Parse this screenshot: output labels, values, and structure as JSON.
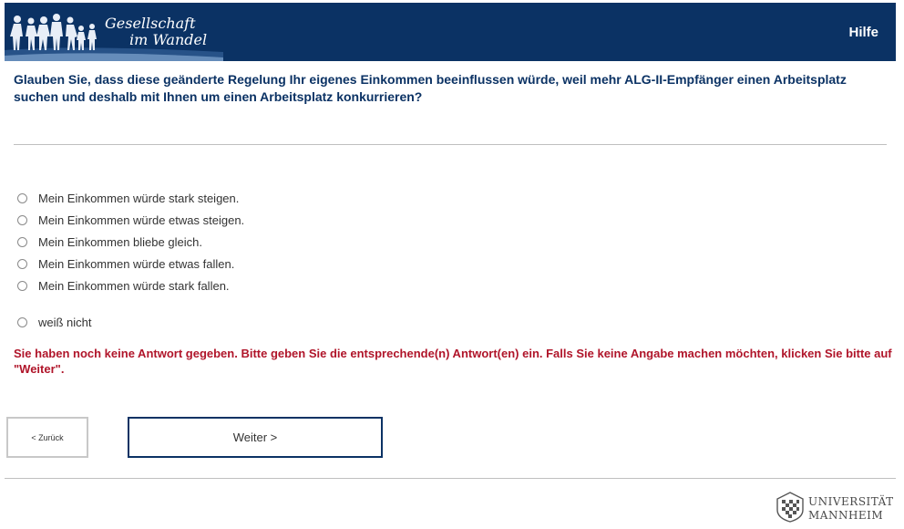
{
  "header": {
    "logo_line1": "Gesellschaft",
    "logo_line2": "im Wandel",
    "help_label": "Hilfe",
    "background": "#0b3264"
  },
  "question": {
    "text": "Glauben Sie, dass diese geänderte Regelung Ihr eigenes Einkommen beeinflussen würde, weil mehr ALG-II-Empfänger einen Arbeitsplatz suchen und deshalb mit Ihnen um einen Arbeitsplatz konkurrieren?",
    "color": "#0b3264"
  },
  "options": [
    {
      "label": "Mein Einkommen würde stark steigen.",
      "selected": false
    },
    {
      "label": "Mein Einkommen würde etwas steigen.",
      "selected": false
    },
    {
      "label": "Mein Einkommen bliebe gleich.",
      "selected": false
    },
    {
      "label": "Mein Einkommen würde etwas fallen.",
      "selected": false
    },
    {
      "label": "Mein Einkommen würde stark fallen.",
      "selected": false
    },
    {
      "label": "weiß nicht",
      "selected": false
    }
  ],
  "error": {
    "text": "Sie haben noch keine Antwort gegeben. Bitte geben Sie die entsprechende(n) Antwort(en) ein. Falls Sie keine Angabe machen möchten, klicken Sie bitte auf \"Weiter\".",
    "color": "#b0152a"
  },
  "buttons": {
    "back_label": "< Zurück",
    "next_label": "Weiter >"
  },
  "footer": {
    "university_line1": "UNIVERSITÄT",
    "university_line2": "MANNHEIM"
  },
  "icons": {
    "logo_figures": "people-silhouettes-icon",
    "university_seal": "university-seal-icon"
  }
}
